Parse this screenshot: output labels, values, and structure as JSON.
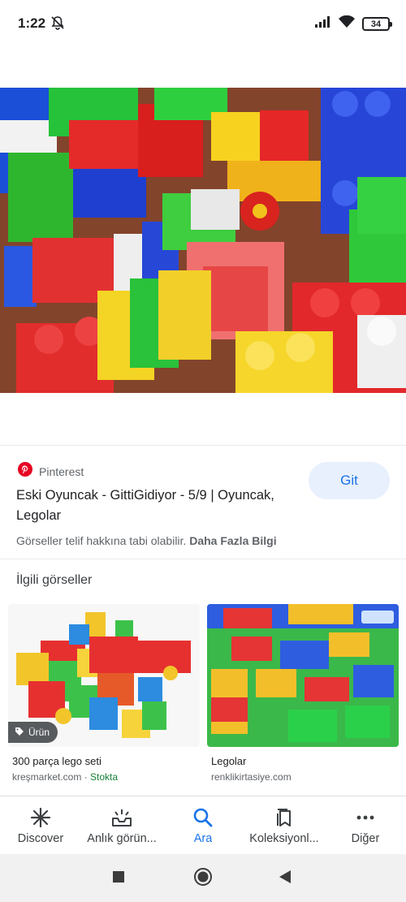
{
  "status_bar": {
    "time": "1:22",
    "battery": "34"
  },
  "viewer": {
    "close_icon": "close-icon",
    "lens_icon": "google-lens-icon",
    "share_icon": "share-icon",
    "save_icon": "bookmark-icon"
  },
  "result": {
    "source": "Pinterest",
    "title": "Eski Oyuncak - GittiGidiyor - 5/9 | Oyuncak, Legolar",
    "visit_label": "Git",
    "copyright_text": "Görseller telif hakkına tabi olabilir.",
    "learn_more": "Daha Fazla Bilgi"
  },
  "related": {
    "heading": "İlgili görseller",
    "items": [
      {
        "title": "300 parça lego seti",
        "source": "kreşmarket.com",
        "stock": "Stokta",
        "badge": "Ürün"
      },
      {
        "title": "Legolar",
        "source": "renklikirtasiye.com"
      }
    ]
  },
  "bottom_nav": {
    "items": [
      {
        "label": "Discover",
        "icon": "asterisk-icon"
      },
      {
        "label": "Anlık görün...",
        "icon": "updates-icon"
      },
      {
        "label": "Ara",
        "icon": "search-icon"
      },
      {
        "label": "Koleksiyonl...",
        "icon": "collections-icon"
      },
      {
        "label": "Diğer",
        "icon": "more-icon"
      }
    ],
    "active_index": 2
  },
  "colors": {
    "accent": "#1a73e8",
    "pinterest": "#e60023",
    "stock": "#188038"
  }
}
